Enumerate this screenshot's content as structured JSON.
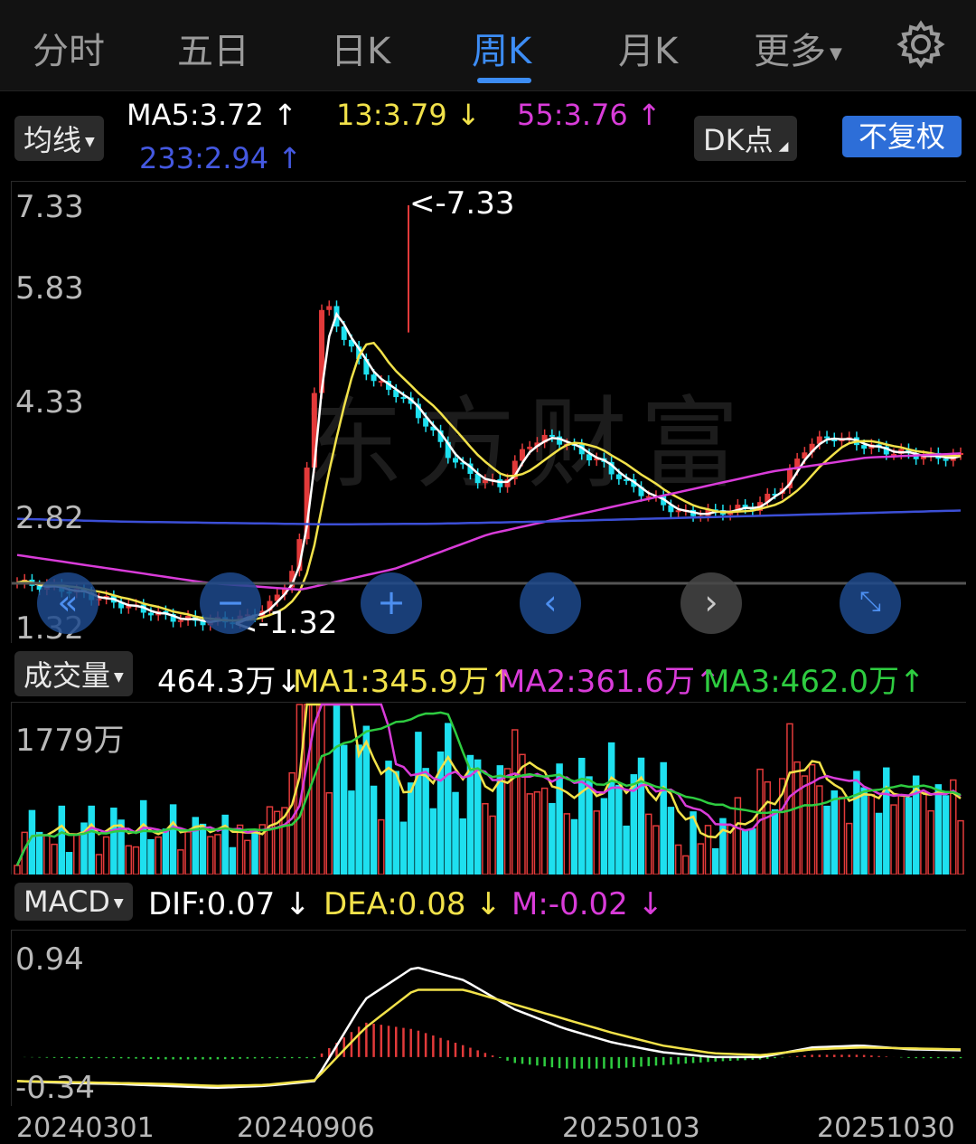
{
  "tabs": [
    {
      "label": "分时"
    },
    {
      "label": "五日"
    },
    {
      "label": "日K"
    },
    {
      "label": "周K",
      "active": true
    },
    {
      "label": "月K"
    },
    {
      "label": "更多"
    }
  ],
  "ma_bar": {
    "selector": "均线",
    "ma5": "MA5:3.72",
    "ma13": "13:3.79",
    "ma55": "55:3.76",
    "ma233": "233:2.94",
    "dk": "DK点",
    "adjust": "不复权"
  },
  "kline": {
    "y_labels": [
      "7.33",
      "5.83",
      "4.33",
      "2.82",
      "1.32"
    ],
    "high_marker": "<-7.33",
    "low_marker": "<-1.32",
    "watermark": "东方财富"
  },
  "volume": {
    "selector": "成交量",
    "current": "464.3万",
    "ma1": "MA1:345.9万",
    "ma2": "MA2:361.6万",
    "ma3": "MA3:462.0万",
    "max_label": "1779万"
  },
  "macd": {
    "selector": "MACD",
    "dif": "DIF:0.07",
    "dea": "DEA:0.08",
    "m": "M:-0.02",
    "top_label": "0.94",
    "bottom_label": "-0.34"
  },
  "dates": [
    "20240301",
    "20240906",
    "20250103",
    "20251030"
  ],
  "colors": {
    "accent": "#3d8df5",
    "up": "#e23a3a",
    "down": "#1ee0ef",
    "ma5": "#ffffff",
    "ma13": "#f2e24a",
    "ma55": "#d93cd9",
    "ma233": "#3c4fd6",
    "macd_green": "#2ecc40"
  },
  "chart_data": {
    "type": "candlestick",
    "y_range": [
      1.32,
      7.33
    ],
    "high": 7.33,
    "low": 1.32,
    "volume_max": "1779万",
    "macd_range": [
      -0.34,
      0.94
    ]
  }
}
